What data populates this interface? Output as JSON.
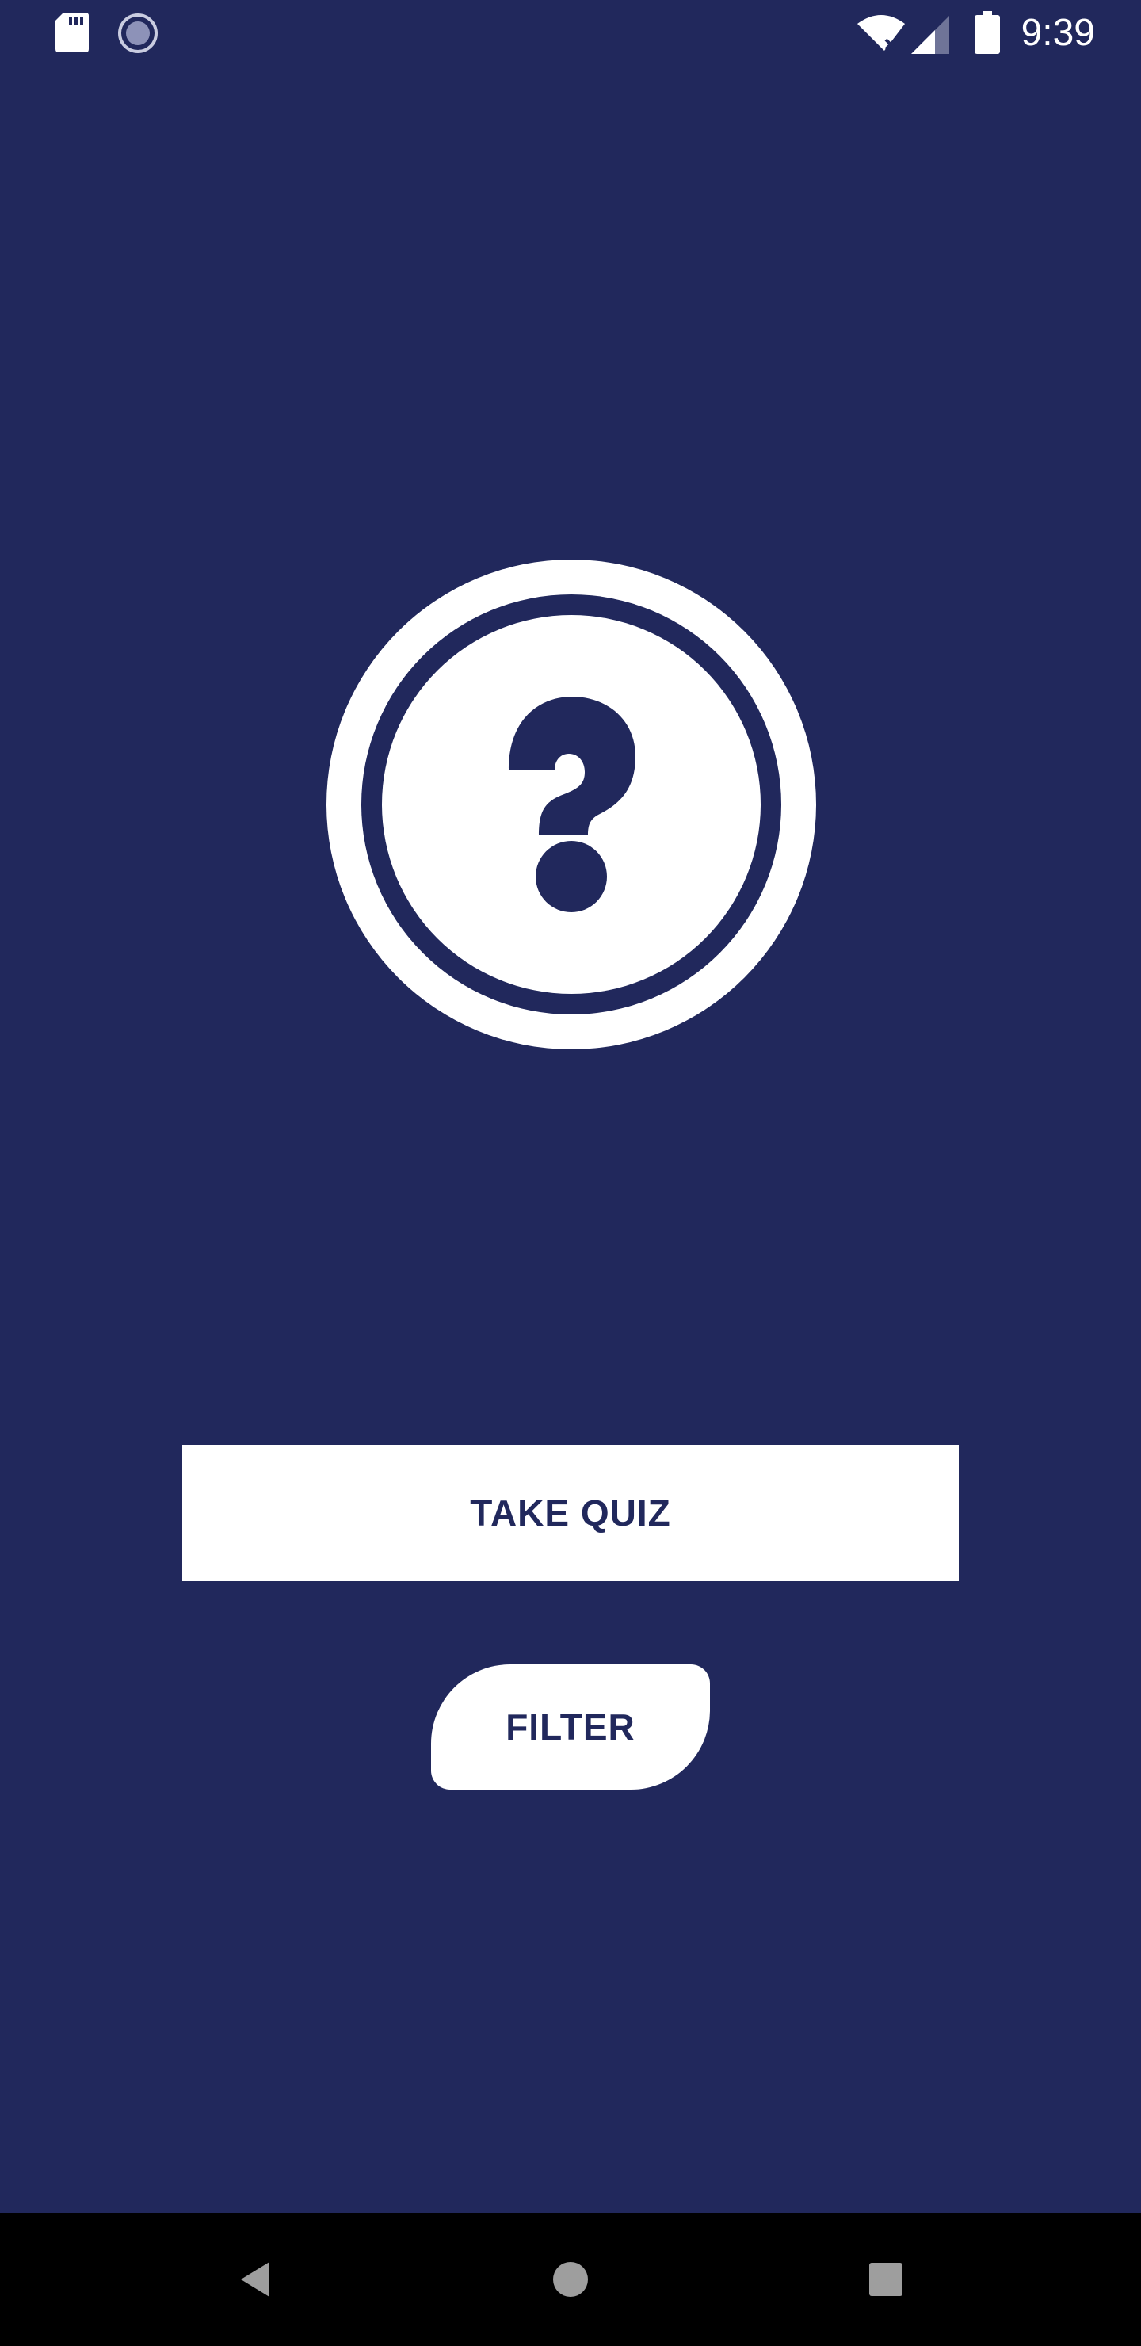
{
  "status_bar": {
    "time": "9:39",
    "icons": [
      "sd-card-icon",
      "sync-icon",
      "wifi-off-icon",
      "cell-signal-icon",
      "battery-icon"
    ]
  },
  "main": {
    "logo_icon": "question-circle-icon",
    "take_quiz_label": "TAKE QUIZ",
    "filter_label": "FILTER"
  },
  "nav_bar": {
    "buttons": [
      "back-icon",
      "home-icon",
      "recents-icon"
    ]
  },
  "colors": {
    "background": "#21285c",
    "button_background": "#ffffff",
    "button_text": "#21285c",
    "nav_bar": "#000000",
    "nav_icon": "#9e9e9e"
  }
}
